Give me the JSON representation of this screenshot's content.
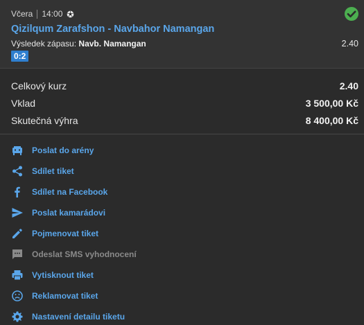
{
  "ticket": {
    "day": "Včera",
    "time": "14:00",
    "sport_icon": "soccer-ball-icon",
    "status_icon": "check-circle-icon",
    "match": "Qizilqum Zarafshon - Navbahor Namangan",
    "result_label": "Výsledek zápasu:",
    "result_value": "Navb. Namangan",
    "odd": "2.40",
    "score": "0:2"
  },
  "summary": {
    "total_odds_label": "Celkový kurz",
    "total_odds_value": "2.40",
    "stake_label": "Vklad",
    "stake_value": "3 500,00 Kč",
    "win_label": "Skutečná výhra",
    "win_value": "8 400,00 Kč"
  },
  "menu": {
    "items": [
      {
        "label": "Poslat do arény",
        "icon": "arena-icon"
      },
      {
        "label": "Sdílet tiket",
        "icon": "share-icon"
      },
      {
        "label": "Sdílet na Facebook",
        "icon": "facebook-icon"
      },
      {
        "label": "Poslat kamarádovi",
        "icon": "send-icon"
      },
      {
        "label": "Pojmenovat tiket",
        "icon": "pencil-icon"
      },
      {
        "label": "Odeslat SMS vyhodnocení",
        "icon": "sms-icon"
      },
      {
        "label": "Vytisknout tiket",
        "icon": "print-icon"
      },
      {
        "label": "Reklamovat tiket",
        "icon": "complaint-face-icon"
      },
      {
        "label": "Nastavení detailu tiketu",
        "icon": "gear-icon"
      }
    ]
  },
  "colors": {
    "accent": "#5aa6ea",
    "success": "#4caf50",
    "score_badge": "#2f7fcf"
  }
}
